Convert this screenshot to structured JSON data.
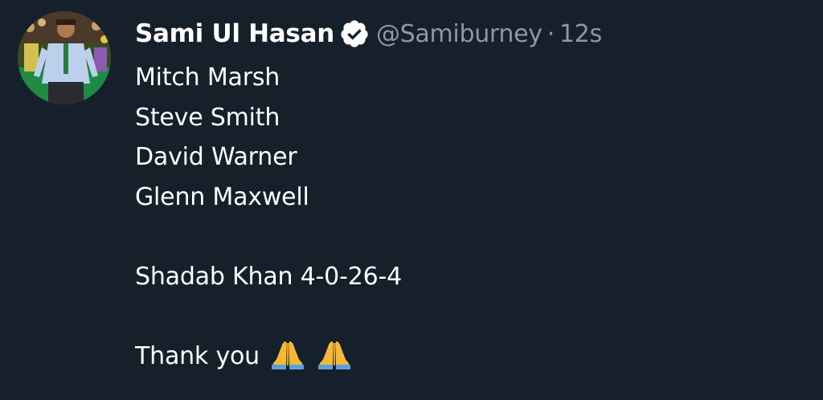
{
  "tweet": {
    "author": {
      "name": "Sami Ul Hasan",
      "handle": "@Samiburney",
      "verified_icon": "verified-badge-icon",
      "avatar": "profile-photo"
    },
    "separator": "·",
    "time": "12s",
    "lines": [
      "Mitch Marsh",
      "Steve Smith",
      "David Warner",
      "Glenn Maxwell",
      "",
      "Shadab Khan 4-0-26-4",
      "",
      "Thank you"
    ],
    "emojis": [
      "folded-hands-icon",
      "folded-hands-icon"
    ],
    "colors": {
      "background": "#15202b",
      "text": "#ffffff",
      "secondary": "#8b98a5",
      "emoji": "#f5b93a"
    }
  }
}
